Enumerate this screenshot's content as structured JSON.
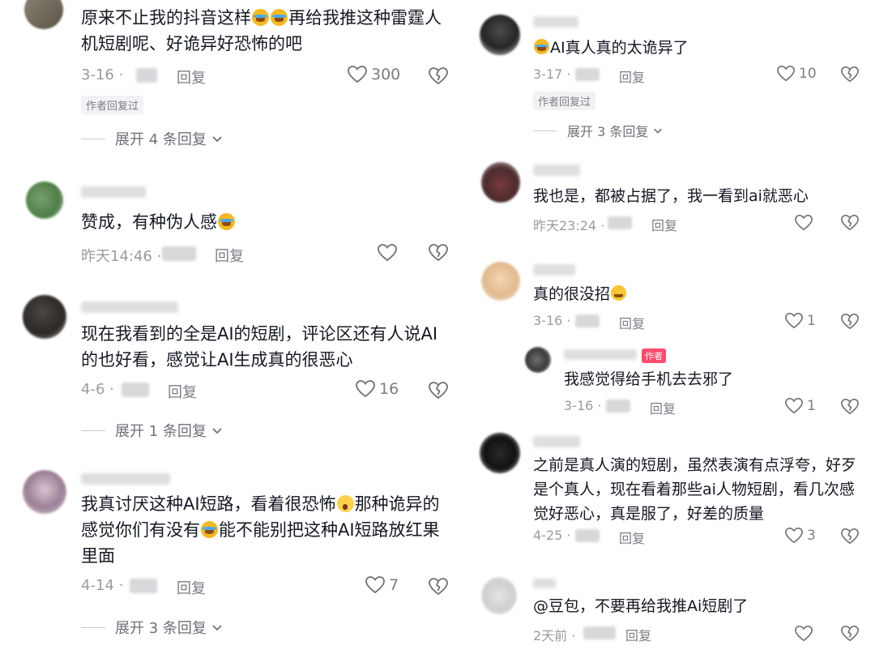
{
  "left": {
    "comments": [
      {
        "text_before": "原来不止我的抖音这样",
        "text_after": "再给我推这种雷霆人机短剧呢、好诡异好恐怖的吧",
        "date": "3-16 ·",
        "reply": "回复",
        "likes": "300",
        "tag": "作者回复过",
        "expand": "展开 4 条回复"
      },
      {
        "text": "赞成，有种伪人感",
        "date": "昨天14:46 ·",
        "reply": "回复",
        "likes": ""
      },
      {
        "text": "现在我看到的全是AI的短剧，评论区还有人说AI的也好看，感觉让AI生成真的很恶心",
        "date": "4-6 ·",
        "reply": "回复",
        "likes": "16",
        "expand": "展开 1 条回复"
      },
      {
        "text_a": "我真讨厌这种AI短路，看着很恐怖",
        "text_b": "那种诡异的感觉你们有没有",
        "text_c": "能不能别把这种AI短路放红果里面",
        "date": "4-14 ·",
        "reply": "回复",
        "likes": "7",
        "expand": "展开 3 条回复"
      }
    ]
  },
  "right": {
    "comments": [
      {
        "text": "AI真人真的太诡异了",
        "date": "3-17 ·",
        "reply": "回复",
        "likes": "10",
        "tag": "作者回复过",
        "expand": "展开 3 条回复"
      },
      {
        "text": "我也是，都被占据了，我一看到ai就恶心",
        "date": "昨天23:24 ·",
        "reply": "回复",
        "likes": ""
      },
      {
        "text": "真的很没招",
        "date": "3-16 ·",
        "reply": "回复",
        "likes": "1"
      },
      {
        "badge": "作者",
        "text": "我感觉得给手机去去邪了",
        "date": "3-16 ·",
        "reply": "回复",
        "likes": "1"
      },
      {
        "text": "之前是真人演的短剧，虽然表演有点浮夸，好歹是个真人，现在看着那些ai人物短剧，看几次感觉好恶心，真是服了，好差的质量",
        "date": "4-25 ·",
        "reply": "回复",
        "likes": "3"
      },
      {
        "text": "@豆包，不要再给我推Ai短剧了",
        "date": "2天前 ·",
        "reply": "回复",
        "likes": ""
      }
    ]
  },
  "colors": {
    "text": "#161823",
    "meta": "#9a9ba1",
    "author_badge": "#fe2c55"
  }
}
